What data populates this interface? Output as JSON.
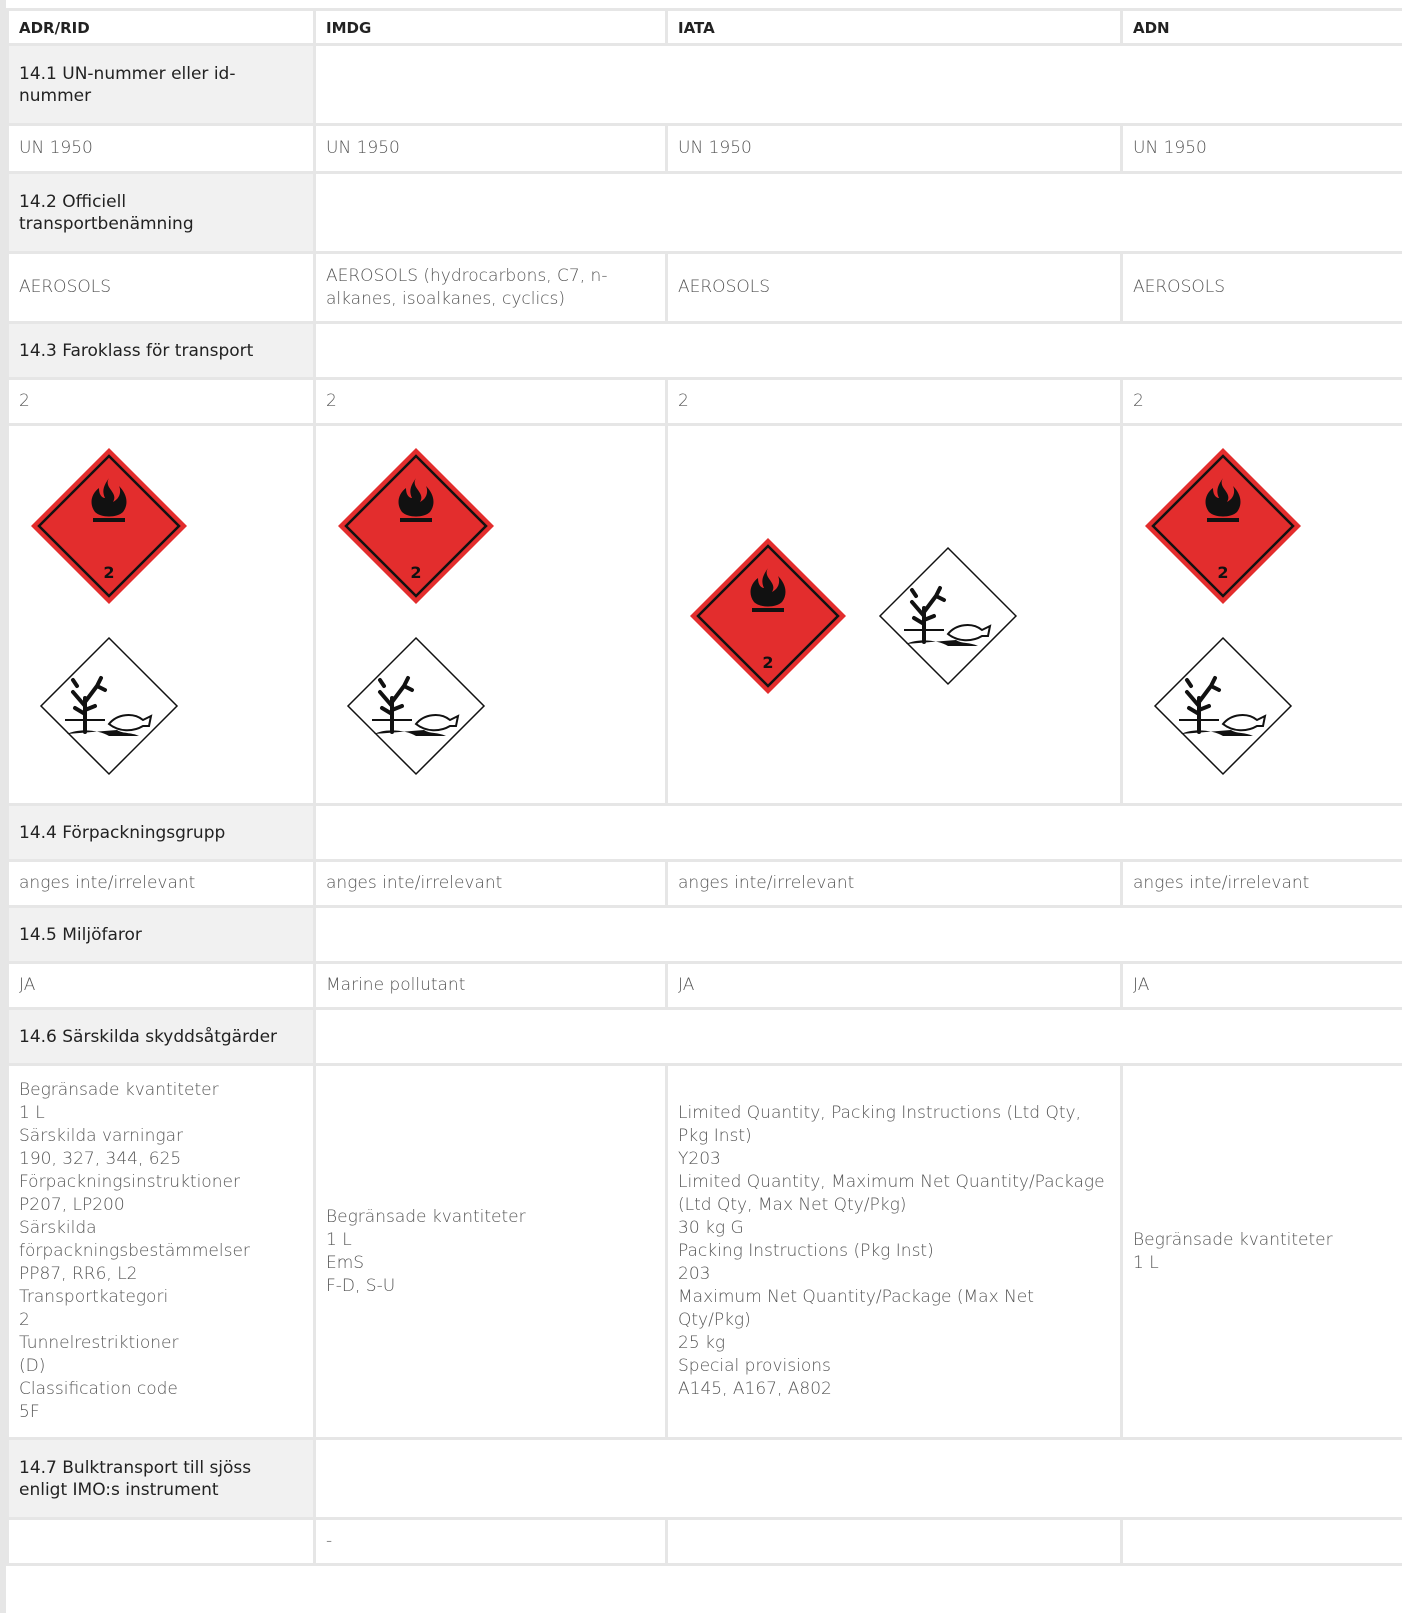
{
  "columns": [
    "ADR/RID",
    "IMDG",
    "IATA",
    "ADN"
  ],
  "sections": {
    "s141": {
      "label": "14.1 UN-nummer eller id-nummer",
      "values": [
        "UN 1950",
        "UN 1950",
        "UN 1950",
        "UN 1950"
      ]
    },
    "s142": {
      "label": "14.2 Officiell transportbenämning",
      "values": [
        "AEROSOLS",
        "AEROSOLS (hydrocarbons, C7, n-alkanes, isoalkanes, cyclics)",
        "AEROSOLS",
        "AEROSOLS"
      ]
    },
    "s143": {
      "label": "14.3 Faroklass för transport",
      "values": [
        "2",
        "2",
        "2",
        "2"
      ],
      "pictogram_number": "2"
    },
    "s144": {
      "label": "14.4 Förpackningsgrupp",
      "values": [
        "anges inte/irrelevant",
        "anges inte/irrelevant",
        "anges inte/irrelevant",
        "anges inte/irrelevant"
      ]
    },
    "s145": {
      "label": "14.5 Miljöfaror",
      "values": [
        "JA",
        "Marine pollutant",
        "JA",
        "JA"
      ]
    },
    "s146": {
      "label": "14.6 Särskilda skyddsåtgärder",
      "adr": [
        "Begränsade kvantiteter",
        "1 L",
        "Särskilda varningar",
        "190, 327, 344, 625",
        "Förpackningsinstruktioner",
        "P207, LP200",
        "Särskilda förpackningsbestämmelser",
        "PP87, RR6, L2",
        "Transportkategori",
        "2",
        "Tunnelrestriktioner",
        "(D)",
        "Classification code",
        "5F"
      ],
      "imdg": [
        "Begränsade kvantiteter",
        "1 L",
        "EmS",
        "F-D, S-U"
      ],
      "iata": [
        "Limited Quantity, Packing Instructions (Ltd Qty, Pkg Inst)",
        "Y203",
        "Limited Quantity, Maximum Net Quantity/Package (Ltd Qty, Max Net Qty/Pkg)",
        "30 kg G",
        "Packing Instructions (Pkg Inst)",
        "203",
        "Maximum Net Quantity/Package (Max Net Qty/Pkg)",
        "25 kg",
        "Special provisions",
        "A145, A167, A802"
      ],
      "adn": [
        "Begränsade kvantiteter",
        "1 L"
      ]
    },
    "s147": {
      "label": "14.7 Bulktransport till sjöss enligt IMO:s instrument",
      "values": [
        "",
        "-",
        "",
        ""
      ]
    }
  },
  "colors": {
    "border": "#e6e6e6",
    "label_bg": "#f1f1f1",
    "flame_diamond": "#e32d2d"
  },
  "icons": [
    "flammable-gas-diamond-icon",
    "environment-hazard-diamond-icon"
  ]
}
